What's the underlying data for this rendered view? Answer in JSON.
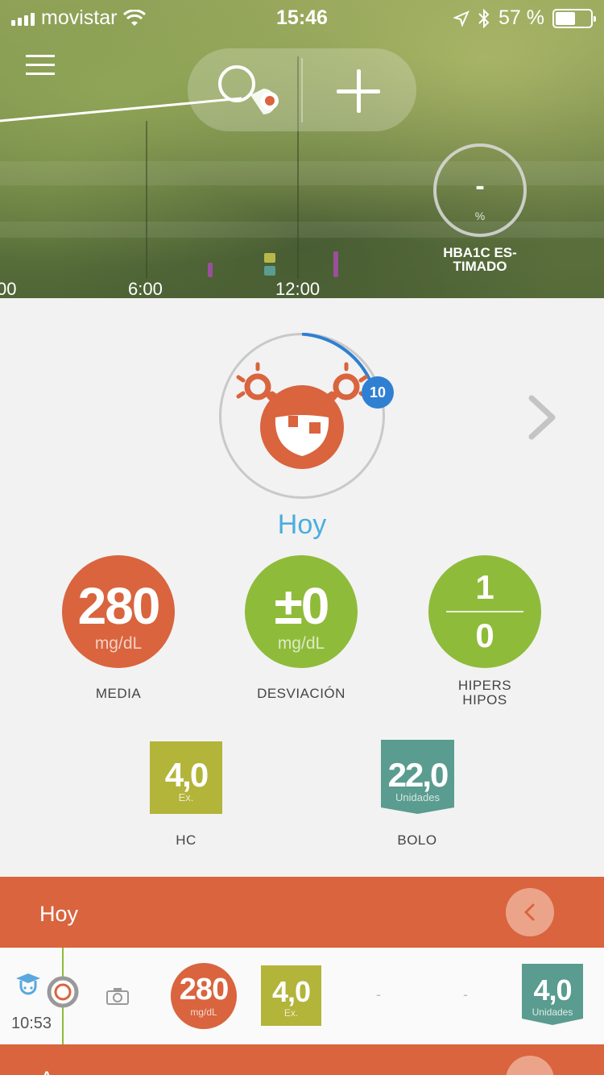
{
  "status_bar": {
    "carrier": "movistar",
    "time": "15:46",
    "battery": "57 %",
    "battery_level": 0.57
  },
  "graph": {
    "axis_labels": [
      "00",
      "6:00",
      "12:00"
    ],
    "hba1c": {
      "value": "-",
      "unit": "%",
      "label": "HBA1C ES-\nTIMADO"
    }
  },
  "summary": {
    "badge": "10",
    "period": "Hoy",
    "stats": {
      "media": {
        "value": "280",
        "unit": "mg/dL",
        "label": "MEDIA"
      },
      "desviacion": {
        "value": "±0",
        "unit": "mg/dL",
        "label": "DESVIACIÓN"
      },
      "hipers_hipos": {
        "hipers": "1",
        "hipos": "0",
        "label_1": "HIPERS",
        "label_2": "HIPOS"
      }
    },
    "hc": {
      "value": "4,0",
      "unit": "Ex.",
      "label": "HC"
    },
    "bolo": {
      "value": "22,0",
      "unit": "Unidades",
      "label": "BOLO"
    }
  },
  "log": {
    "section_title": "Hoy",
    "entries": [
      {
        "time": "10:53",
        "glucose": "280",
        "glucose_unit": "mg/dL",
        "carbs": "4,0",
        "carbs_unit": "Ex.",
        "col_a": "-",
        "col_b": "-",
        "insulin": "4,0",
        "insulin_unit": "Unidades"
      }
    ],
    "next_section_title": "A"
  },
  "colors": {
    "orange": "#d9643e",
    "green": "#8fbb3a",
    "olive": "#b3b43a",
    "teal": "#5a9c8f",
    "blue": "#4aaede",
    "badge_blue": "#2f7fd3"
  }
}
